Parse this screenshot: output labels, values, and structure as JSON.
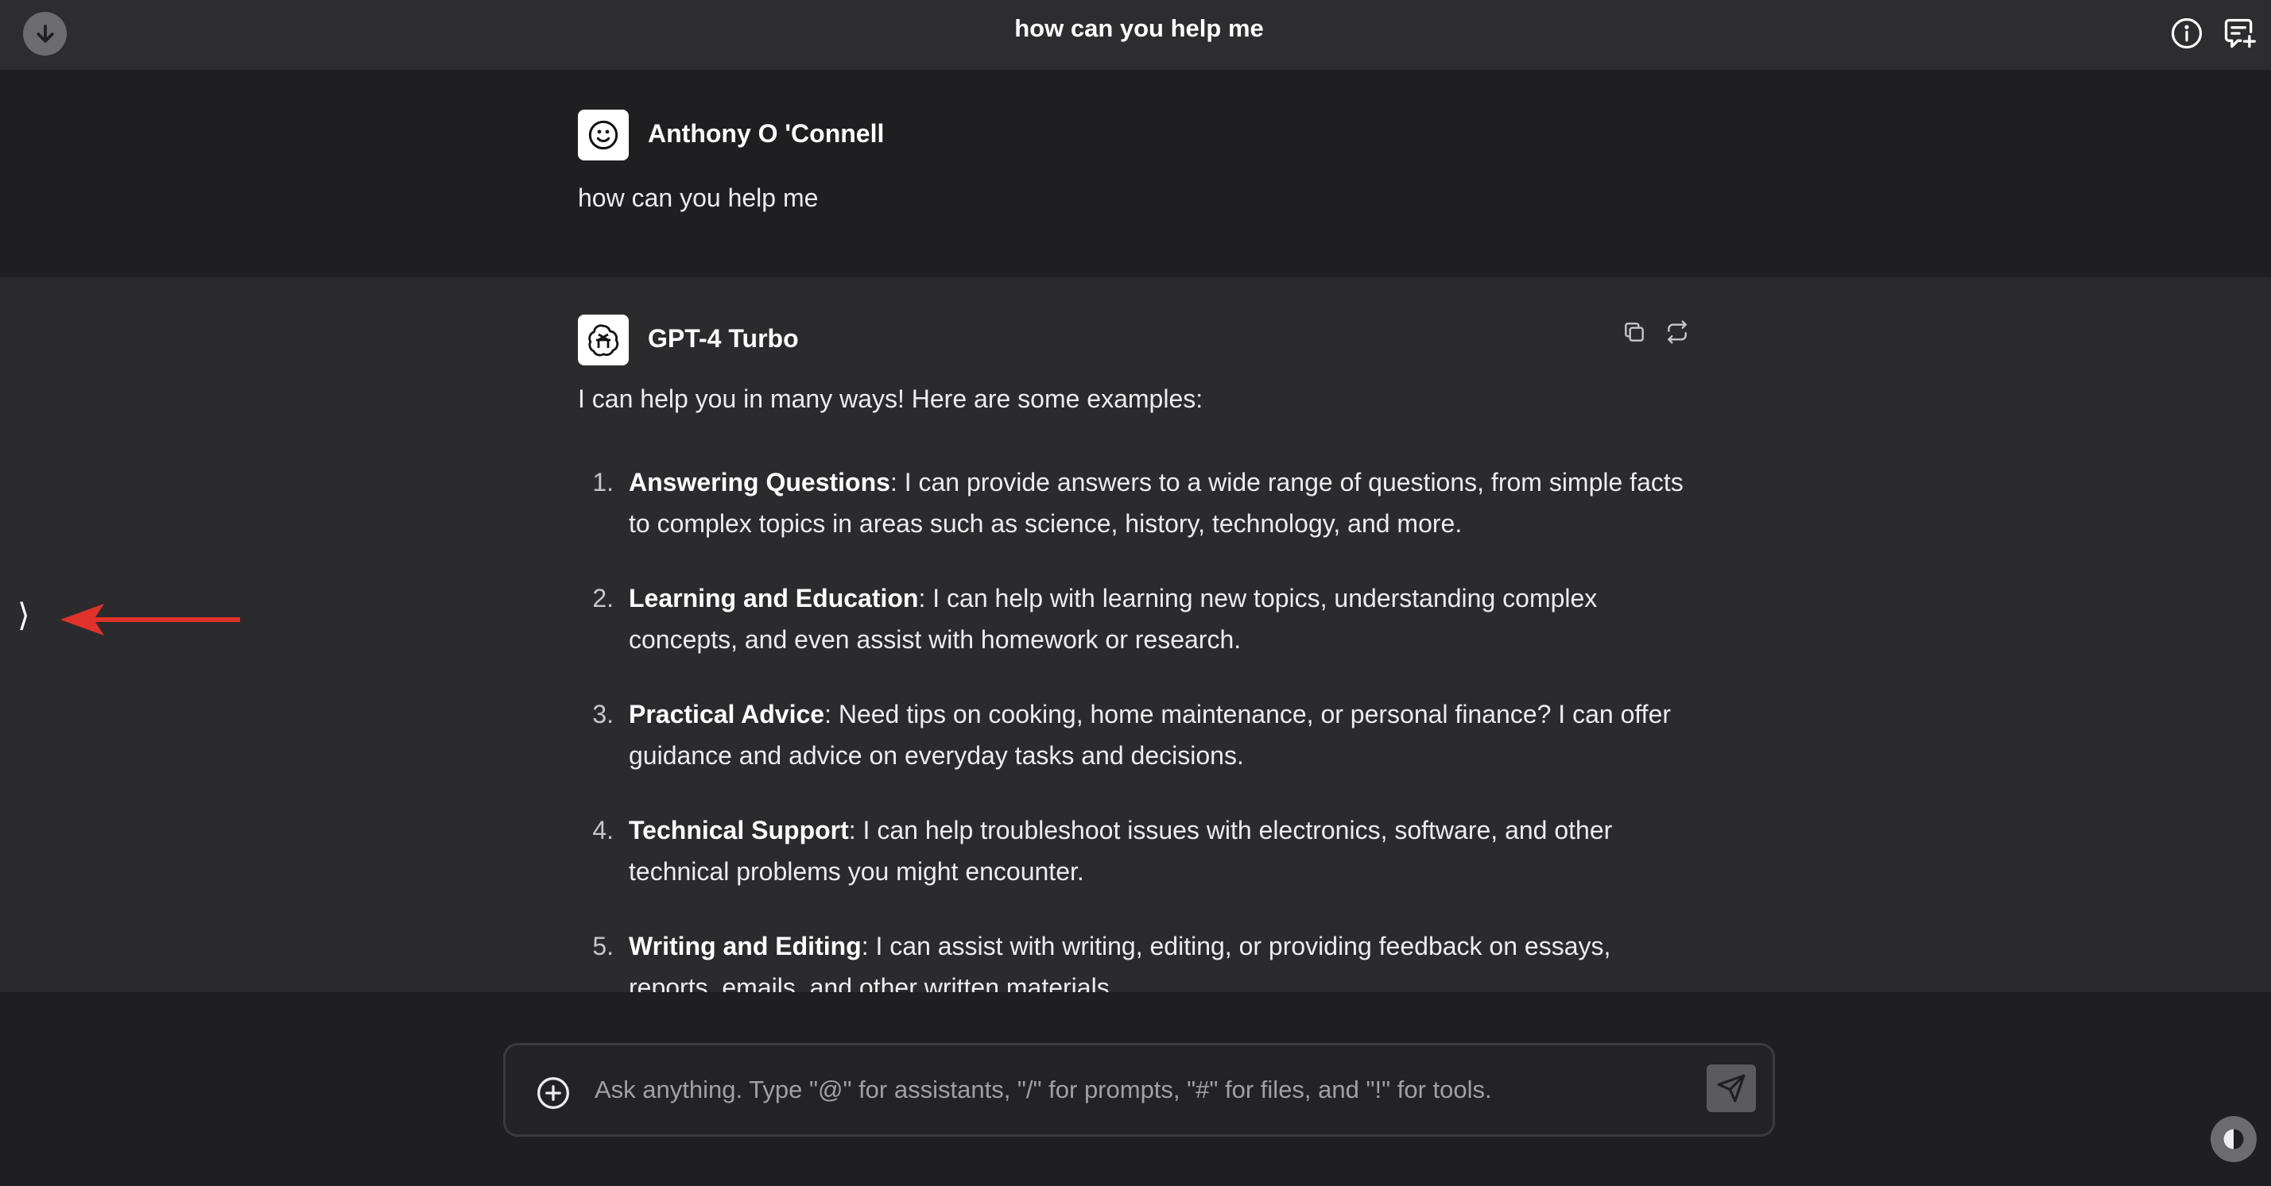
{
  "header": {
    "title": "how can you help me"
  },
  "user_message": {
    "author": "Anthony O 'Connell",
    "text": "how can you help me"
  },
  "assistant_message": {
    "author": "GPT-4 Turbo",
    "intro": "I can help you in many ways! Here are some examples:",
    "items": [
      {
        "num": "1.",
        "title": "Answering Questions",
        "text": ": I can provide answers to a wide range of questions, from simple facts to complex topics in areas such as science, history, technology, and more."
      },
      {
        "num": "2.",
        "title": "Learning and Education",
        "text": ": I can help with learning new topics, understanding complex concepts, and even assist with homework or research."
      },
      {
        "num": "3.",
        "title": "Practical Advice",
        "text": ": Need tips on cooking, home maintenance, or personal finance? I can offer guidance and advice on everyday tasks and decisions."
      },
      {
        "num": "4.",
        "title": "Technical Support",
        "text": ": I can help troubleshoot issues with electronics, software, and other technical problems you might encounter."
      },
      {
        "num": "5.",
        "title": "Writing and Editing",
        "text": ": I can assist with writing, editing, or providing feedback on essays, reports, emails, and other written materials."
      }
    ]
  },
  "side_toggle": {
    "glyph": "⟩"
  },
  "composer": {
    "placeholder": "Ask anything. Type \"@\" for assistants, \"/\" for prompts, \"#\" for files, and \"!\" for tools."
  },
  "colors": {
    "annotation_arrow": "#e0322a",
    "header_bg": "#2d2d30",
    "assistant_bg": "#2b2b2e",
    "user_bg": "#1f1f21"
  }
}
